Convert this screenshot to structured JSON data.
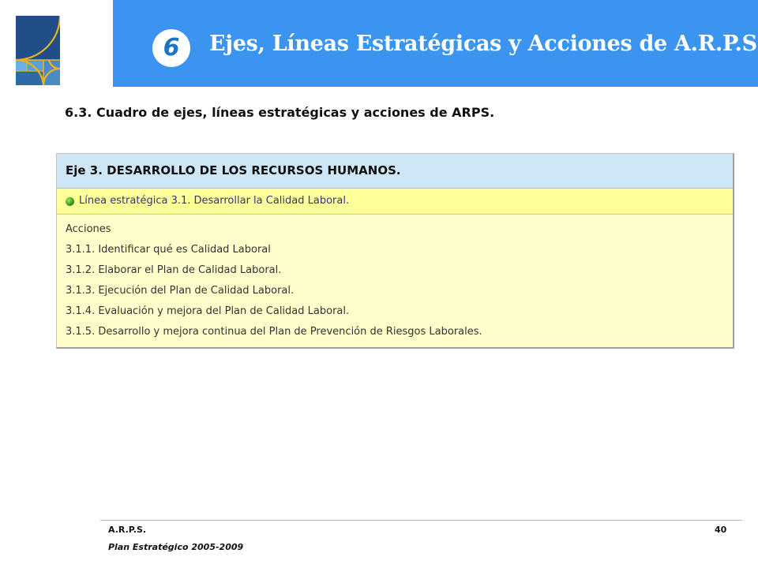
{
  "header": {
    "badge": "6",
    "title": "Ejes, Líneas Estratégicas y Acciones de A.R.P.S.",
    "banner_color": "#3a94f0"
  },
  "section_title": "6.3. Cuadro de ejes, líneas estratégicas y acciones de ARPS.",
  "table": {
    "eje": "Eje  3. DESARROLLO DE LOS RECURSOS HUMANOS.",
    "linea": "Línea estratégica 3.1. Desarrollar la Calidad Laboral.",
    "acciones_label": "Acciones",
    "acciones": [
      "3.1.1. Identificar qué es Calidad Laboral",
      "3.1.2. Elaborar el Plan de Calidad Laboral.",
      "3.1.3. Ejecución del Plan de Calidad Laboral.",
      "3.1.4. Evaluación y mejora del Plan de Calidad Laboral.",
      "3.1.5. Desarrollo y mejora continua del Plan de Prevención de Riesgos Laborales."
    ],
    "colors": {
      "eje_bg": "#cfe6f7",
      "linea_bg": "#ffff99",
      "acciones_bg": "#ffffcc"
    }
  },
  "footer": {
    "org": "A.R.P.S.",
    "plan": "Plan Estratégico 2005-2009",
    "page": "40"
  }
}
